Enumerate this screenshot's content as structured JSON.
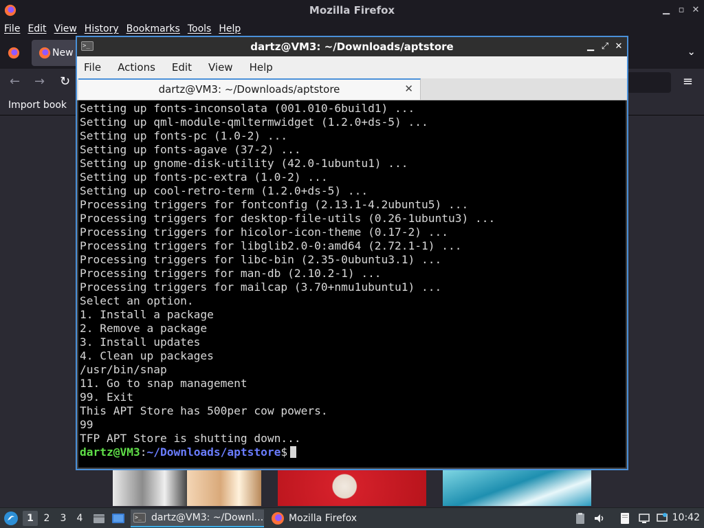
{
  "firefox": {
    "window_title": "Mozilla Firefox",
    "menu": [
      "File",
      "Edit",
      "View",
      "History",
      "Bookmarks",
      "Tools",
      "Help"
    ],
    "tab_label": "New",
    "bookmarks_import": "Import book"
  },
  "terminal": {
    "window_title": "dartz@VM3: ~/Downloads/aptstore",
    "menu": [
      "File",
      "Actions",
      "Edit",
      "View",
      "Help"
    ],
    "tab_label": "dartz@VM3: ~/Downloads/aptstore",
    "lines": [
      "Setting up fonts-inconsolata (001.010-6build1) ...",
      "Setting up qml-module-qmltermwidget (1.2.0+ds-5) ...",
      "Setting up fonts-pc (1.0-2) ...",
      "Setting up fonts-agave (37-2) ...",
      "Setting up gnome-disk-utility (42.0-1ubuntu1) ...",
      "Setting up fonts-pc-extra (1.0-2) ...",
      "Setting up cool-retro-term (1.2.0+ds-5) ...",
      "Processing triggers for fontconfig (2.13.1-4.2ubuntu5) ...",
      "Processing triggers for desktop-file-utils (0.26-1ubuntu3) ...",
      "Processing triggers for hicolor-icon-theme (0.17-2) ...",
      "Processing triggers for libglib2.0-0:amd64 (2.72.1-1) ...",
      "Processing triggers for libc-bin (2.35-0ubuntu3.1) ...",
      "Processing triggers for man-db (2.10.2-1) ...",
      "Processing triggers for mailcap (3.70+nmu1ubuntu1) ...",
      "Select an option.",
      "1. Install a package",
      "2. Remove a package",
      "3. Install updates",
      "4. Clean up packages",
      "/usr/bin/snap",
      "11. Go to snap management",
      "99. Exit",
      "This APT Store has 500per cow powers.",
      "99",
      "TFP APT Store is shutting down..."
    ],
    "prompt_user": "dartz@VM3",
    "prompt_sep": ":",
    "prompt_path": "~/Downloads/aptstore",
    "prompt_symbol": "$"
  },
  "taskbar": {
    "workspaces": [
      "1",
      "2",
      "3",
      "4"
    ],
    "active_workspace": "1",
    "tasks": [
      {
        "label": "dartz@VM3: ~/Downl...",
        "icon": "terminal-icon",
        "active": true
      },
      {
        "label": "Mozilla Firefox",
        "icon": "firefox-icon",
        "active": false
      }
    ],
    "clock": "10:42"
  },
  "colors": {
    "terminal_bg": "#000000",
    "terminal_text": "#d8d8d8",
    "prompt_user": "#5fdf48",
    "prompt_path": "#6a7dff",
    "window_border": "#4a90d9"
  }
}
